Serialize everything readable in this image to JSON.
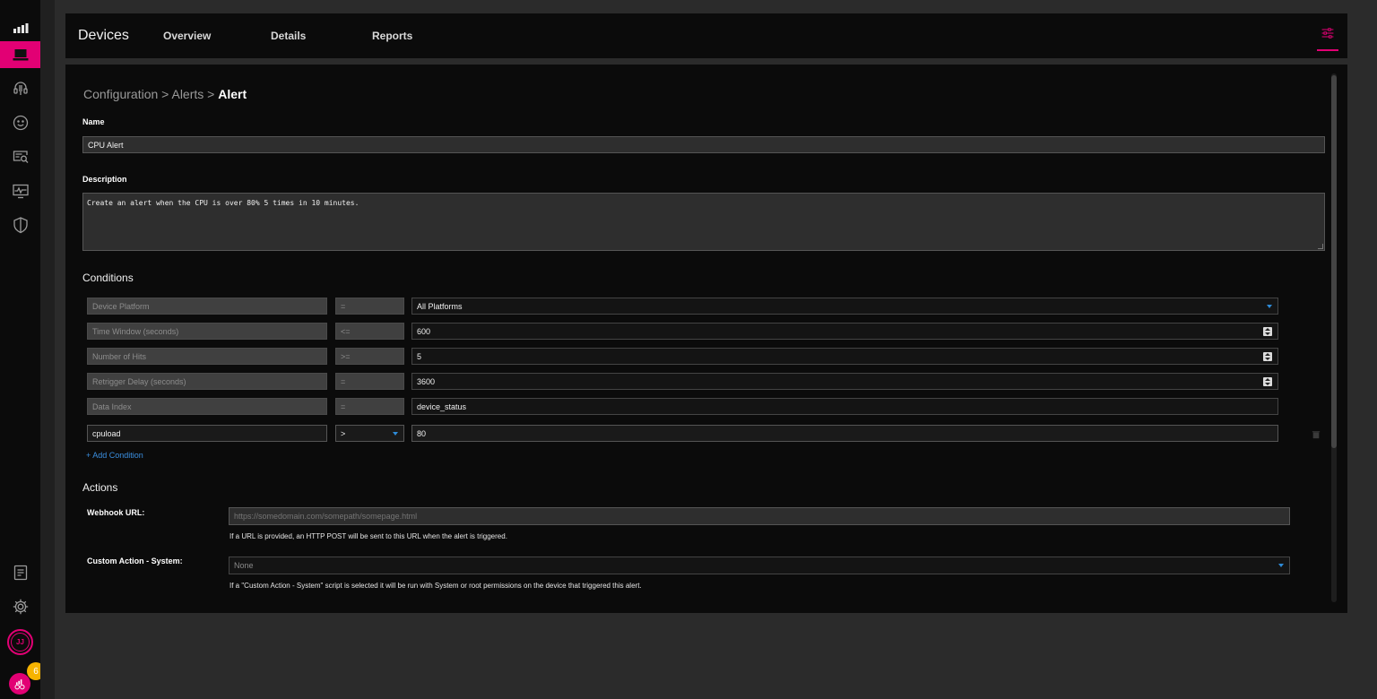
{
  "header": {
    "app_title": "Devices",
    "tabs": [
      {
        "label": "Overview"
      },
      {
        "label": "Details"
      },
      {
        "label": "Reports"
      }
    ]
  },
  "sidebar": {
    "items": [
      {
        "icon": "signal-bars-icon"
      },
      {
        "icon": "laptop-icon",
        "active": true
      },
      {
        "icon": "headset-icon"
      },
      {
        "icon": "smiley-icon"
      },
      {
        "icon": "search-screen-icon"
      },
      {
        "icon": "monitor-pulse-icon"
      },
      {
        "icon": "shield-icon"
      }
    ],
    "bottom_items": [
      {
        "icon": "notes-icon"
      },
      {
        "icon": "gear-icon"
      }
    ],
    "avatar_initials": "JJ",
    "notification_count": "6"
  },
  "breadcrumb": {
    "parts": [
      "Configuration",
      "Alerts"
    ],
    "separator": ">",
    "current": "Alert"
  },
  "form": {
    "name_label": "Name",
    "name_value": "CPU Alert",
    "description_label": "Description",
    "description_value": "Create an alert when the CPU is over 80% 5 times in 10 minutes."
  },
  "conditions": {
    "title": "Conditions",
    "rows": [
      {
        "field": "Device Platform",
        "operator": "=",
        "value": "All Platforms",
        "value_control": "select"
      },
      {
        "field": "Time Window (seconds)",
        "operator": "<=",
        "value": "600",
        "value_control": "number"
      },
      {
        "field": "Number of Hits",
        "operator": ">=",
        "value": "5",
        "value_control": "number"
      },
      {
        "field": "Retrigger Delay (seconds)",
        "operator": "=",
        "value": "3600",
        "value_control": "number"
      },
      {
        "field": "Data Index",
        "operator": "=",
        "value": "device_status",
        "value_control": "text"
      },
      {
        "field": "cpuload",
        "operator": ">",
        "value": "80",
        "value_control": "text",
        "editable": true
      }
    ],
    "add_label": "+ Add Condition"
  },
  "actions": {
    "title": "Actions",
    "webhook_label": "Webhook URL:",
    "webhook_placeholder": "https://somedomain.com/somepath/somepage.html",
    "webhook_help": "If a URL is provided, an HTTP POST will be sent to this URL when the alert is triggered.",
    "custom_label": "Custom Action - System:",
    "custom_value": "None",
    "custom_help": "If a \"Custom Action - System\" script is selected it will be run with System or root permissions on the device that triggered this alert."
  },
  "colors": {
    "accent": "#e20074",
    "link": "#3b8fe0",
    "badge": "#f6b300",
    "background": "#0b0b0b"
  }
}
